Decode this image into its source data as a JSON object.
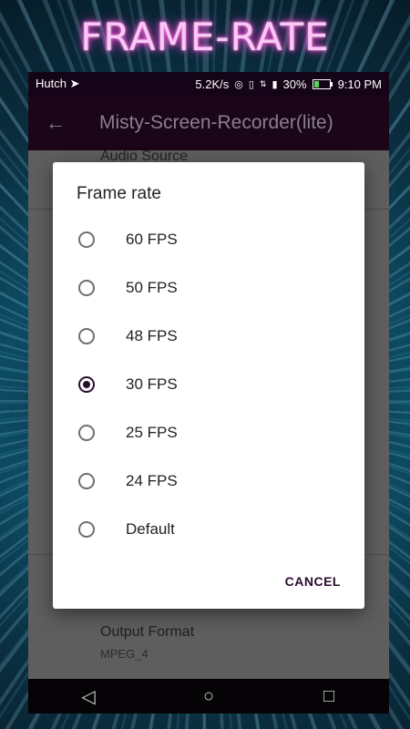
{
  "banner": {
    "title": "FRAME-RATE"
  },
  "status_bar": {
    "carrier": "Hutch",
    "network_speed": "5.2K/s",
    "battery": "30%",
    "time": "9:10 PM",
    "icons": [
      "telegram-icon",
      "hotspot-icon",
      "vibrate-icon",
      "data-icon",
      "signal-icon",
      "battery-icon"
    ]
  },
  "app_bar": {
    "title": "Misty-Screen-Recorder(lite)",
    "back_icon": "arrow-left-icon"
  },
  "settings": {
    "partial_item": "Audio Source",
    "output_format_title": "Output Format",
    "output_format_value": "MPEG_4"
  },
  "dialog": {
    "title": "Frame rate",
    "options": [
      {
        "label": "60 FPS",
        "selected": false
      },
      {
        "label": "50 FPS",
        "selected": false
      },
      {
        "label": "48 FPS",
        "selected": false
      },
      {
        "label": "30 FPS",
        "selected": true
      },
      {
        "label": "25 FPS",
        "selected": false
      },
      {
        "label": "24 FPS",
        "selected": false
      },
      {
        "label": "Default",
        "selected": false
      }
    ],
    "cancel_label": "CANCEL"
  },
  "nav_bar": {
    "back": "◁",
    "home": "○",
    "recents": "□"
  },
  "colors": {
    "accent": "#2a0c2e",
    "app_bar": "#1a0519",
    "banner_glow": "#ff4fd8"
  }
}
